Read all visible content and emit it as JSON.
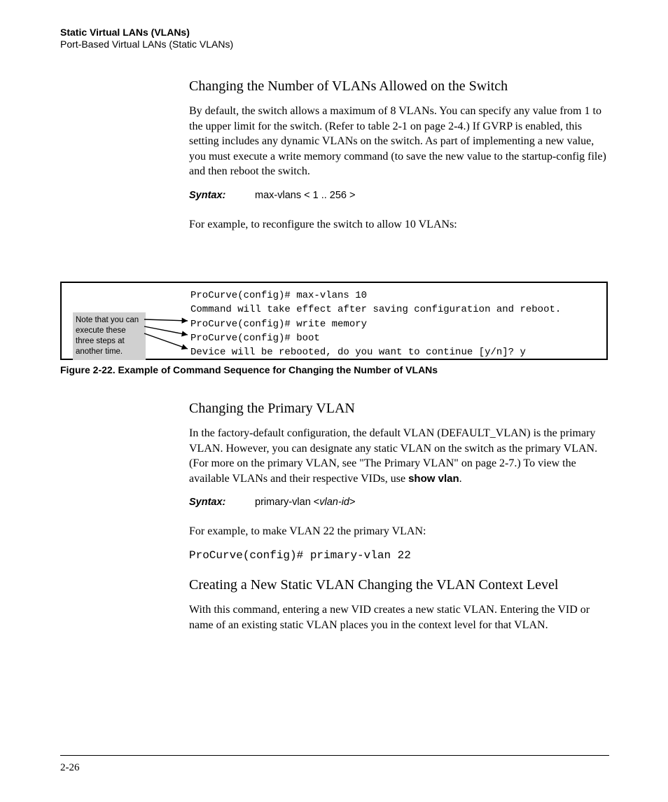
{
  "header": {
    "title": "Static Virtual LANs (VLANs)",
    "subtitle": "Port-Based Virtual LANs (Static VLANs)"
  },
  "section1": {
    "heading": "Changing the Number of VLANs Allowed on the Switch",
    "para1": "By default, the switch allows a maximum of 8 VLANs. You can specify any value from 1 to the upper limit for the switch. (Refer to table 2-1 on page 2-4.) If GVRP is enabled, this setting includes any dynamic VLANs on the switch. As part of implementing a new value, you must execute a write memory command (to save the new value to the startup-config file) and then reboot the switch.",
    "syntax_label": "Syntax:",
    "syntax_body": "max-vlans < 1 .. 256 >",
    "para2": "For example, to reconfigure the switch to allow 10 VLANs:"
  },
  "figure": {
    "callout": "Note that you can execute these three steps at another time.",
    "terminal": "ProCurve(config)# max-vlans 10\nCommand will take effect after saving configuration and reboot.\nProCurve(config)# write memory\nProCurve(config)# boot\nDevice will be rebooted, do you want to continue [y/n]? y",
    "caption": "Figure 2-22.  Example of Command Sequence for Changing the Number of VLANs"
  },
  "section2": {
    "heading": "Changing the Primary VLAN",
    "para1_a": "In the factory-default configuration, the default VLAN (DEFAULT_VLAN) is the primary VLAN. However, you can designate any static VLAN on the switch as the primary VLAN. (For more on the primary VLAN, see \"The Primary VLAN\" on page 2-7.) To view the available VLANs and their respective VIDs, use ",
    "para1_b": "show vlan",
    "para1_c": ".",
    "syntax_label": "Syntax:",
    "syntax_body_a": "primary-vlan <",
    "syntax_body_b": "vlan-id",
    "syntax_body_c": ">",
    "para2": "For example, to make VLAN 22 the primary VLAN:",
    "cmd": "ProCurve(config)# primary-vlan 22"
  },
  "section3": {
    "heading": "Creating a New Static VLAN Changing the VLAN Context Level",
    "para1": "With this command, entering a new VID creates a new static VLAN. Entering the VID or name of an existing static VLAN places you in the context level for that VLAN."
  },
  "footer": {
    "page": "2-26"
  }
}
